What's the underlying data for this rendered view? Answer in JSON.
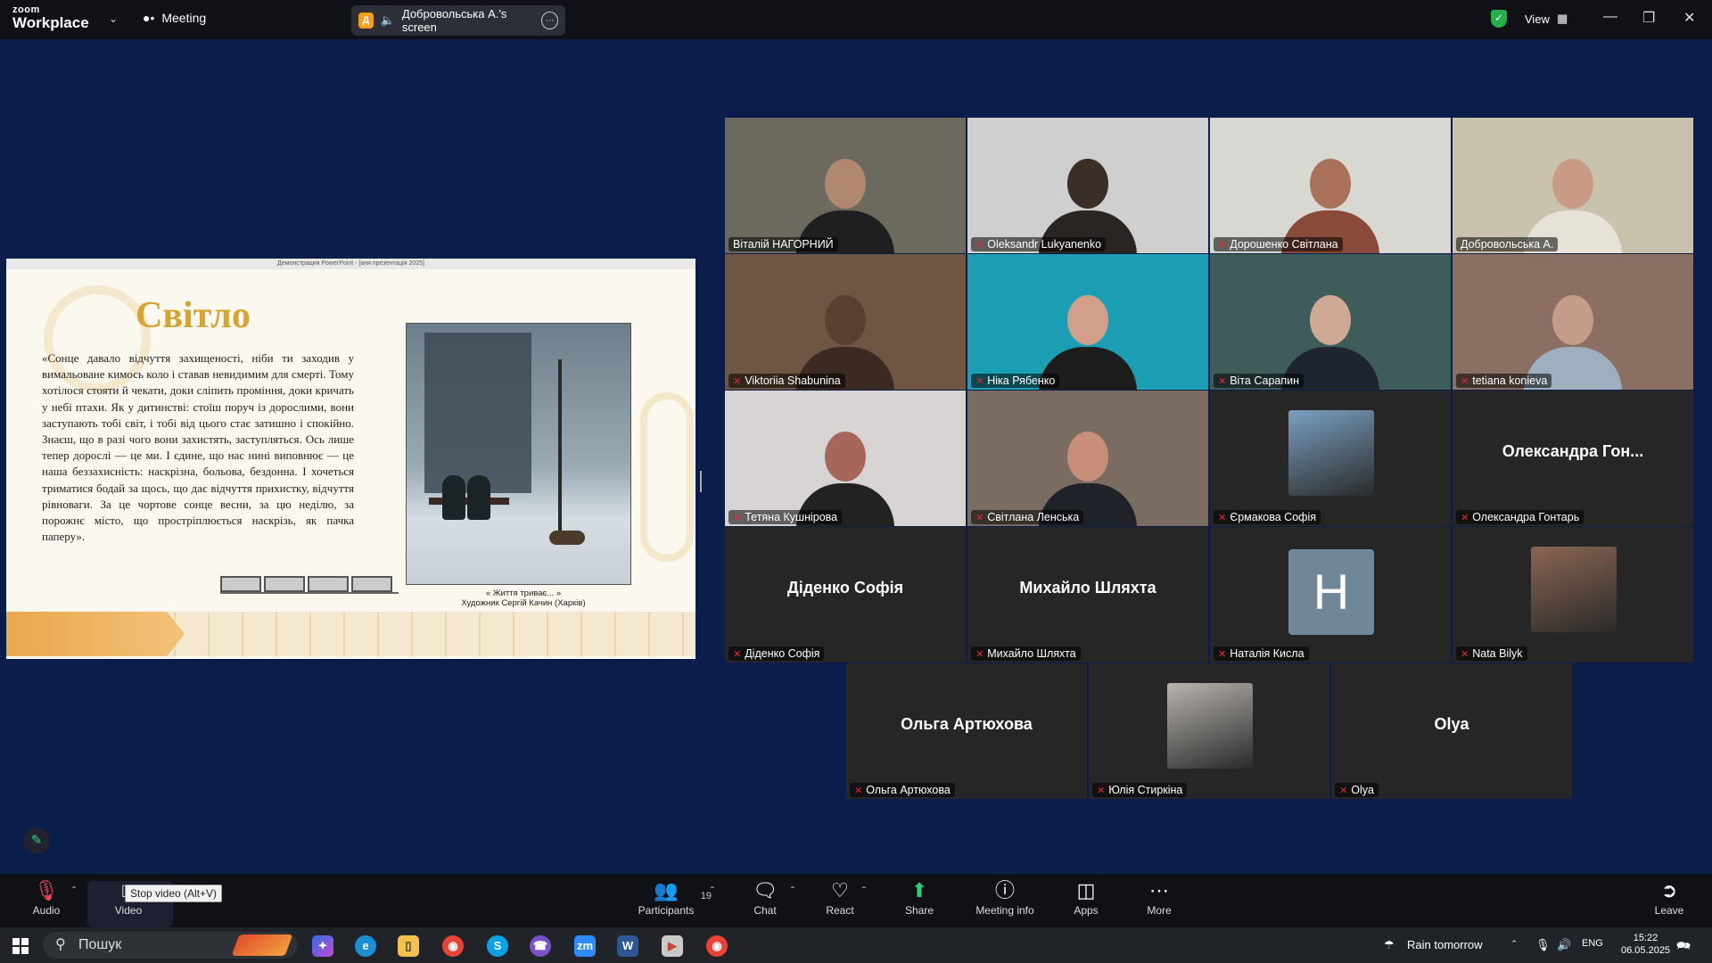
{
  "app": {
    "logo_line1": "zoom",
    "logo_line2": "Workplace",
    "meeting_label": "Meeting",
    "view_label": "View"
  },
  "share_banner": {
    "initial": "Д",
    "text": "Добровольська А.'s screen"
  },
  "slide": {
    "window_title": "Демонстрация PowerPoint - [аня презентація 2025]",
    "title": "Світло",
    "quote": "«Сонце давало відчуття захищеності, ніби ти заходив у вимальоване кимось коло і ставав невидимим для смерті. Тому хотілося стояти й чекати, доки сліпить проміння, доки кричать у небі птахи. Як у дитинстві: стоїш поруч із дорослими, вони заступають тобі світ, і тобі від цього стає затишно і спокійно. Знаєш, що в разі чого вони захистять, заступляться. Ось лише тепер дорослі — це ми. І єдине, що нас нині виповнює — це наша беззахисність: наскрізна, больова, бездонна. І хочеться триматися бодай за щось, що дає відчуття прихистку, відчуття рівноваги. За це чортове сонце весни, за цю неділю, за порожнє місто, що простріплюється наскрізь, як пачка паперу».",
    "caption_line1": "« Життя триває... »",
    "caption_line2": "Художник Сергій Качин (Харків)"
  },
  "participants": [
    {
      "name": "Віталій НАГОРНИЙ",
      "muted": false,
      "type": "video",
      "bg": "#6c6a5e",
      "skin": "#b08870",
      "shirt": "#1f1f22"
    },
    {
      "name": "Oleksandr Lukyanenko",
      "muted": true,
      "type": "video",
      "bg": "#cfcfcf",
      "skin": "#3a2e28",
      "shirt": "#2a2422"
    },
    {
      "name": "Дорошенко Світлана",
      "muted": true,
      "type": "video",
      "bg": "#d8d8d2",
      "skin": "#a9705a",
      "shirt": "#8a4a3a"
    },
    {
      "name": "Добровольська А.",
      "muted": false,
      "type": "video",
      "bg": "#c9c3ad",
      "skin": "#c99a85",
      "shirt": "#e7e2d8"
    },
    {
      "name": "Viktoriia Shabunina",
      "muted": true,
      "type": "video",
      "bg": "#6e5642",
      "skin": "#5a4030",
      "shirt": "#3a2a22"
    },
    {
      "name": "Ніка Рябенко",
      "muted": true,
      "type": "video",
      "bg": "#1c9fb4",
      "skin": "#d2a08a",
      "shirt": "#1d1d1d"
    },
    {
      "name": "Віта Сарапин",
      "muted": true,
      "type": "video",
      "bg": "#3d5c5a",
      "skin": "#d0a896",
      "shirt": "#1e2430"
    },
    {
      "name": "tetiana konieva",
      "muted": true,
      "type": "video",
      "bg": "#8a6f62",
      "skin": "#c69c8a",
      "shirt": "#9eb0c0"
    },
    {
      "name": "Тетяна Кушнірова",
      "muted": true,
      "type": "video",
      "bg": "#d8d4d4",
      "skin": "#a6665a",
      "shirt": "#222222"
    },
    {
      "name": "Світлана Ленська",
      "muted": true,
      "type": "video",
      "bg": "#7a6c60",
      "skin": "#c98e7a",
      "shirt": "#1f2228"
    },
    {
      "name": "Єрмакова Софія",
      "muted": true,
      "type": "photo",
      "bg": "#7aa0c0"
    },
    {
      "name": "Олександра Гонтарь",
      "muted": true,
      "type": "text",
      "big": "Олександра  Гон..."
    },
    {
      "name": "Діденко Софія",
      "muted": true,
      "type": "text",
      "big": "Діденко Софія"
    },
    {
      "name": "Михайло Шляхта",
      "muted": true,
      "type": "text",
      "big": "Михайло Шляхта"
    },
    {
      "name": "Наталія Кисла",
      "muted": true,
      "type": "initial",
      "big": "Н"
    },
    {
      "name": "Nata Bilyk",
      "muted": true,
      "type": "photo",
      "bg": "#8a6652"
    },
    {
      "name": "Ольга Артюхова",
      "muted": true,
      "type": "text",
      "big": "Ольга Артюхова"
    },
    {
      "name": "Юлія Стиркіна",
      "muted": true,
      "type": "photo",
      "bg": "#b8b4ae"
    },
    {
      "name": "Olya",
      "muted": true,
      "type": "text",
      "big": "Olya"
    }
  ],
  "toolbar": {
    "audio": "Audio",
    "video": "Video",
    "video_tooltip": "Stop video (Alt+V)",
    "participants": "Participants",
    "participants_count": "19",
    "chat": "Chat",
    "react": "React",
    "share": "Share",
    "meeting_info": "Meeting info",
    "apps": "Apps",
    "more": "More",
    "leave": "Leave"
  },
  "taskbar": {
    "search_placeholder": "Пошук",
    "weather": "Rain tomorrow",
    "lang": "ENG",
    "time": "15:22",
    "date": "06.05.2025"
  },
  "colors": {
    "active_speaker": "#39d08a",
    "muted_icon": "#ee2233",
    "share_green": "#2fd07a",
    "slide_gold": "#d5a431"
  }
}
